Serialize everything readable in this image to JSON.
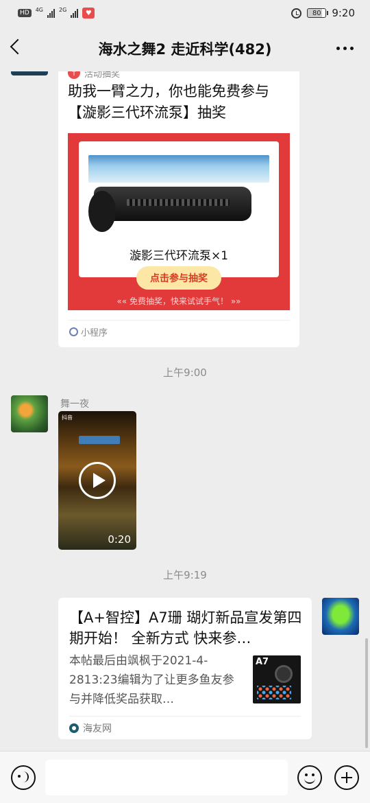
{
  "status_bar": {
    "chip": "HD",
    "net1": "4G",
    "net2": "2G",
    "battery": "80",
    "time": "9:20"
  },
  "nav": {
    "title": "海水之舞2 走近科学(482)"
  },
  "mini_program_card": {
    "source": "活动抽奖",
    "title": "助我一臂之力，你也能免费参与【漩影三代环流泵】抽奖",
    "prize_caption": "漩影三代环流泵×1",
    "join_button": "点击参与抽奖",
    "subtitle": "«« 免费抽奖，快来试试手气！ »»",
    "footer": "小程序"
  },
  "timestamps": [
    "上午9:00",
    "上午9:19"
  ],
  "video_message": {
    "sender": "舞一夜",
    "tag": "抖音",
    "duration": "0:20"
  },
  "link_card": {
    "title": "【A+智控】A7珊 瑚灯新品宣发第四期开始！ 全新方式  快来参…",
    "description": "本帖最后由飒枫于2021-4-2813:23编辑为了让更多鱼友参与并降低奖品获取…",
    "thumb_label": "A7",
    "source": "海友网"
  },
  "input_bar": {
    "placeholder": ""
  }
}
